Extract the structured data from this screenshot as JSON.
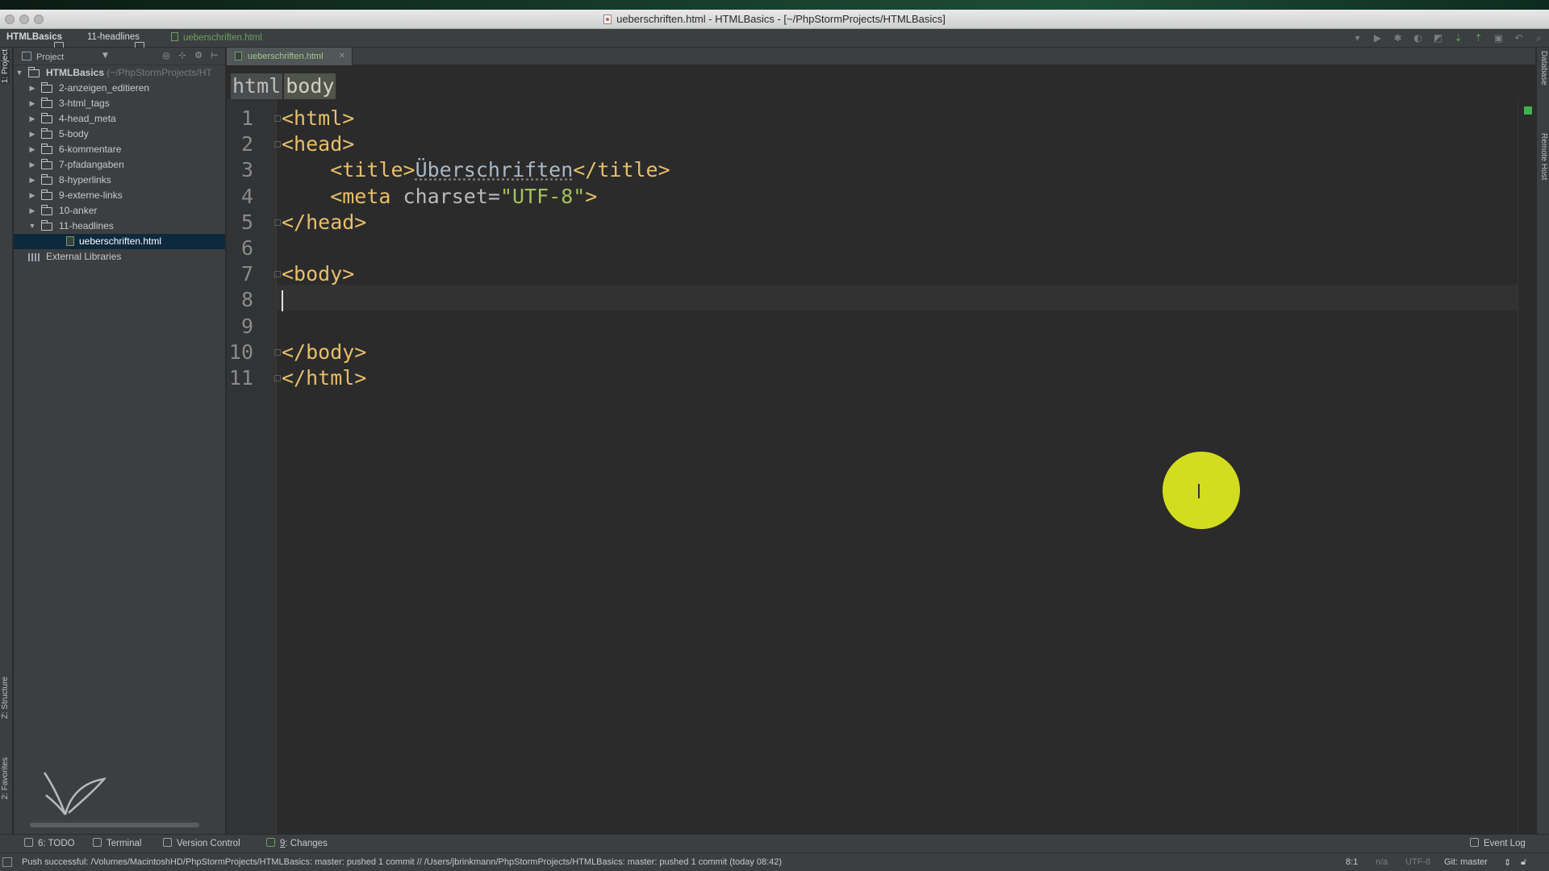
{
  "window": {
    "title": "ueberschriften.html - HTMLBasics - [~/PhpStormProjects/HTMLBasics]"
  },
  "navbar": {
    "crumbs": [
      "HTMLBasics",
      "11-headlines",
      "ueberschriften.html"
    ]
  },
  "left_strip": {
    "project_label": "1: Project",
    "structure_label": "Z: Structure",
    "favorites_label": "2: Favorites"
  },
  "right_strip": {
    "database_label": "Database",
    "remote_host_label": "Remote Host"
  },
  "project_panel": {
    "title": "Project",
    "root": {
      "label": "HTMLBasics",
      "hint": "(~/PhpStormProjects/HT"
    },
    "folders": [
      "2-anzeigen_editieren",
      "3-html_tags",
      "4-head_meta",
      "5-body",
      "6-kommentare",
      "7-pfadangaben",
      "8-hyperlinks",
      "9-externe-links",
      "10-anker",
      "11-headlines"
    ],
    "selected_file": "ueberschriften.html",
    "external_libraries": "External Libraries"
  },
  "editor": {
    "tab_label": "ueberschriften.html",
    "breadcrumb": [
      "html",
      "body"
    ],
    "current_line": 8,
    "lines": [
      {
        "n": "1",
        "parts": [
          {
            "t": "<html>",
            "c": "tag"
          }
        ]
      },
      {
        "n": "2",
        "parts": [
          {
            "t": "<head>",
            "c": "tag"
          }
        ]
      },
      {
        "n": "3",
        "parts": [
          {
            "t": "    <title>",
            "c": "tag"
          },
          {
            "t": "Überschriften",
            "c": "txt"
          },
          {
            "t": "</title>",
            "c": "tag"
          }
        ]
      },
      {
        "n": "4",
        "parts": [
          {
            "t": "    <meta ",
            "c": "tag"
          },
          {
            "t": "charset=",
            "c": "attr"
          },
          {
            "t": "\"UTF-8\"",
            "c": "str"
          },
          {
            "t": ">",
            "c": "tag"
          }
        ]
      },
      {
        "n": "5",
        "parts": [
          {
            "t": "</head>",
            "c": "tag"
          }
        ]
      },
      {
        "n": "6",
        "parts": []
      },
      {
        "n": "7",
        "parts": [
          {
            "t": "<body>",
            "c": "tag"
          }
        ]
      },
      {
        "n": "8",
        "parts": []
      },
      {
        "n": "9",
        "parts": []
      },
      {
        "n": "10",
        "parts": [
          {
            "t": "</body>",
            "c": "tag"
          }
        ]
      },
      {
        "n": "11",
        "parts": [
          {
            "t": "</html>",
            "c": "tag"
          }
        ]
      }
    ]
  },
  "bottom_tools": {
    "todo": "6: TODO",
    "terminal": "Terminal",
    "version_control": "Version Control",
    "changes_num": "9",
    "changes_label": ": Changes",
    "event_log": "Event Log"
  },
  "status": {
    "message": "Push successful: /Volumes/MacintoshHD/PhpStormProjects/HTMLBasics: master: pushed 1 commit // /Users/jbrinkmann/PhpStormProjects/HTMLBasics: master: pushed 1 commit (today 08:42)",
    "position": "8:1",
    "na": "n/a",
    "encoding": "UTF-8",
    "git": "Git: master"
  },
  "colors": {
    "editor_bg": "#2b2b2b",
    "panel_bg": "#3c3f41",
    "tag": "#e8bf6a",
    "string": "#a5c25c",
    "selection": "#0d293e",
    "cursor_highlight": "#d3dd1f"
  }
}
